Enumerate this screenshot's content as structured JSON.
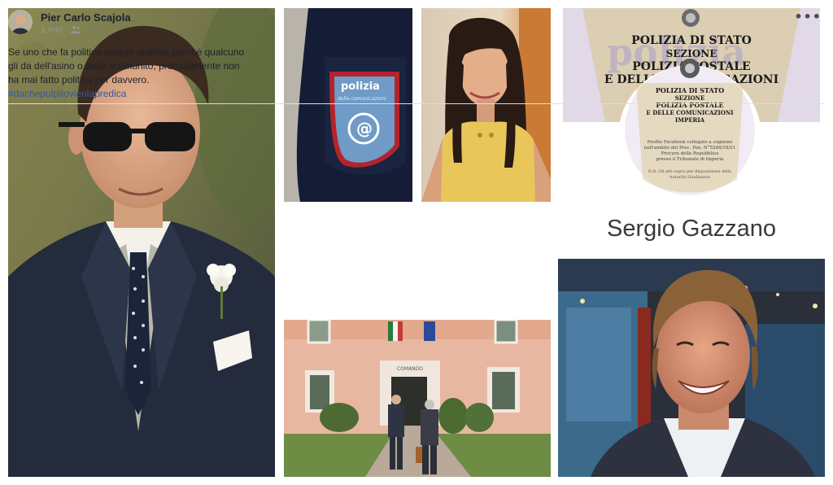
{
  "post": {
    "author": "Pier Carlo Scajola",
    "time": "1 min",
    "meta_separator": "·",
    "more_icon": "more-horizontal-icon",
    "body_lines": [
      "Se uno che fa politica sporge querela perché qualcuno",
      "gli da dell'asino o dello scemunito, probabilmente non",
      "ha mai fatto politica per davvero."
    ],
    "hashtag": "#dachepulpitovienlapredica"
  },
  "patch": {
    "line1": "polizia",
    "line2": "delle comunicazioni"
  },
  "seal": {
    "title_line1": "POLIZIA DI STATO",
    "title_line2": "SEZIONE",
    "title_line3": "POLIZIA POSTALE",
    "title_line4": "E DELLE COMUNICAZIONI",
    "watermark": "polizia",
    "stamp_line1": "POLIZIA DI STATO",
    "stamp_line2": "SEZIONE",
    "stamp_line3": "POLIZIA POSTALE",
    "stamp_line4": "E DELLE COMUNICAZIONI",
    "stamp_line5": "IMPERIA",
    "stamp_small1": "Profilo Facebook collegato a cognomi",
    "stamp_small2": "nell'ambito del Proc. Pen. N°5246/18/21",
    "stamp_small3": "Procura della Repubblica",
    "stamp_small4": "presso il Tribunale di Imperia",
    "stamp_small5": "N.B. Gli atti sopra per disposizione della",
    "stamp_small6": "Autorità Giudiziaria"
  },
  "person_name": "Sergio Gazzano",
  "building": {
    "sign": "COMANDO"
  }
}
